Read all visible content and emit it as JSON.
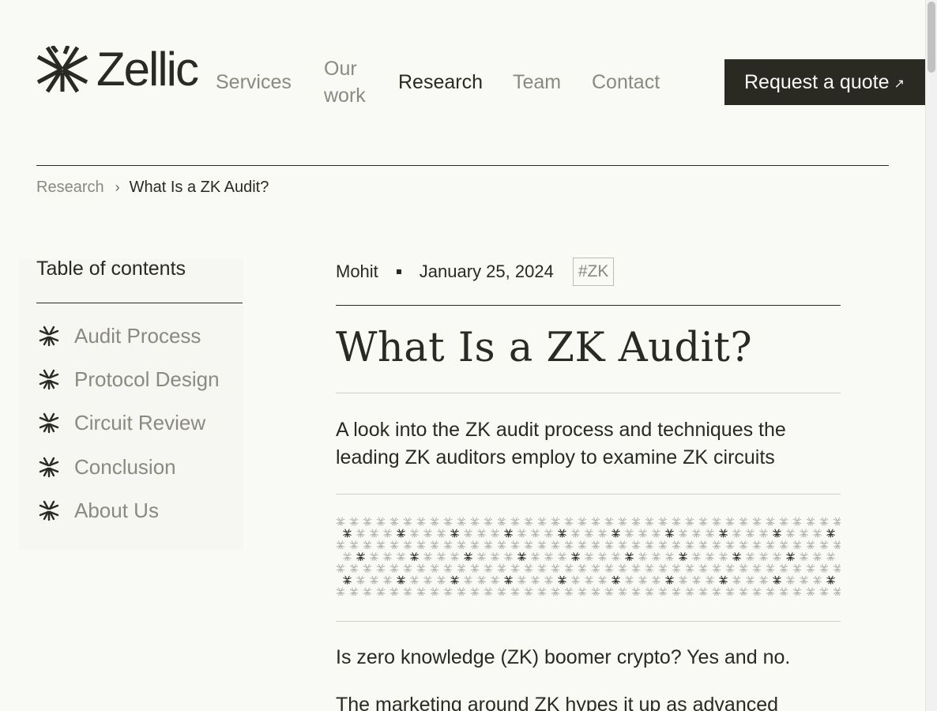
{
  "header": {
    "logo_text": "Zellic",
    "nav": [
      {
        "label": "Services",
        "active": false
      },
      {
        "label": "Our work",
        "active": false
      },
      {
        "label": "Research",
        "active": true
      },
      {
        "label": "Team",
        "active": false
      },
      {
        "label": "Contact",
        "active": false
      }
    ],
    "cta_label": "Request a quote",
    "cta_icon": "arrow-up-right-icon"
  },
  "breadcrumb": {
    "parent": "Research",
    "separator_icon": "chevron-right-icon",
    "current": "What Is a ZK Audit?"
  },
  "toc": {
    "title": "Table of contents",
    "item_icon": "zellic-star-icon",
    "items": [
      {
        "label": "Audit Process"
      },
      {
        "label": "Protocol Design"
      },
      {
        "label": "Circuit Review"
      },
      {
        "label": "Conclusion"
      },
      {
        "label": "About Us"
      }
    ]
  },
  "article": {
    "author": "Mohit",
    "date": "January 25, 2024",
    "tag": "#ZK",
    "title": "What Is a ZK Audit?",
    "subtitle": "A look into the ZK audit process and techniques the leading ZK auditors employ to examine ZK circuits",
    "paragraphs": [
      "Is zero knowledge (ZK) boomer crypto? Yes and no.",
      "The marketing around ZK hypes it up as advanced"
    ]
  },
  "colors": {
    "background": "#f9f9f6",
    "text": "#2a2a24",
    "muted": "#8a8a80",
    "cta_bg": "#2b2a22"
  }
}
